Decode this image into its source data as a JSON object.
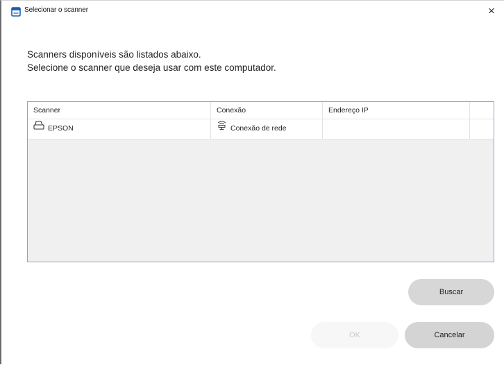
{
  "window": {
    "title": "Selecionar o scanner",
    "close_label": "×",
    "app_icon": "scanner-app-icon"
  },
  "instructions": {
    "line1": "Scanners disponíveis são listados abaixo.",
    "line2": "Selecione o scanner que deseja usar com este computador."
  },
  "scanner_list": {
    "columns": [
      "Scanner",
      "Conexão",
      "Endereço IP",
      ""
    ],
    "rows": [
      {
        "scanner": "EPSON",
        "scanner_icon": "printer-icon",
        "connection": "Conexão de rede",
        "connection_icon": "network-icon",
        "ip_address": ""
      }
    ]
  },
  "buttons": {
    "search": "Buscar",
    "ok": "OK",
    "cancel": "Cancelar"
  },
  "colors": {
    "accent": "#1a5fb4",
    "list_border": "#8fa3bf",
    "button_gray": "#d7d7d7",
    "button_disabled": "#f7f7f7"
  }
}
